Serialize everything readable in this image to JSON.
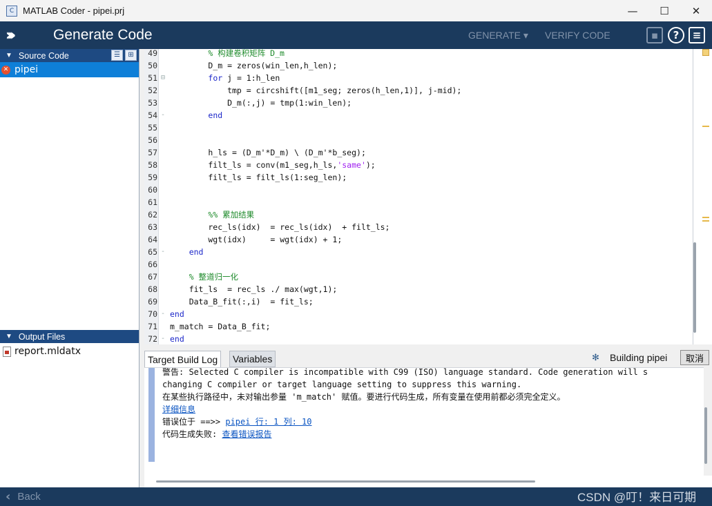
{
  "window": {
    "title": "MATLAB Coder - pipei.prj",
    "app_icon": "matlab-coder-icon",
    "minimize": "—",
    "maximize": "☐",
    "close": "✕"
  },
  "header": {
    "title": "Generate Code",
    "menu_generate": "GENERATE ▾",
    "menu_verify": "VERIFY CODE",
    "save_icon": "save-icon",
    "help_icon": "?",
    "menu_icon": "≡"
  },
  "source_panel": {
    "title": "Source Code",
    "items": [
      {
        "label": "pipei",
        "status": "error"
      }
    ]
  },
  "output_panel": {
    "title": "Output Files",
    "items": [
      {
        "label": "report.mldatx"
      }
    ]
  },
  "editor": {
    "lines": [
      {
        "n": "49",
        "html": "        <span class=\"cm\">% 构建卷积矩阵 D_m</span>"
      },
      {
        "n": "50",
        "html": "        D_m = zeros(win_len,h_len);"
      },
      {
        "n": "51",
        "html": "        <span class=\"kw\">for</span> j = 1:h_len",
        "fold": "⊟"
      },
      {
        "n": "52",
        "html": "            tmp = circshift([m1_seg; zeros(h_len,1)], j-mid);"
      },
      {
        "n": "53",
        "html": "            D_m(:,j) = tmp(1:win_len);"
      },
      {
        "n": "54",
        "html": "        <span class=\"kw\">end</span>",
        "fold": "-"
      },
      {
        "n": "55",
        "html": ""
      },
      {
        "n": "56",
        "html": ""
      },
      {
        "n": "57",
        "html": "        h_ls = (D_m'*D_m) \\ (D_m'*b_seg);"
      },
      {
        "n": "58",
        "html": "        filt_ls = conv(m1_seg,h_ls,<span class=\"str\">'same'</span>);"
      },
      {
        "n": "59",
        "html": "        filt_ls = filt_ls(1:seg_len);"
      },
      {
        "n": "60",
        "html": ""
      },
      {
        "n": "61",
        "html": ""
      },
      {
        "n": "62",
        "html": "        <span class=\"cm\">%% 累加结果</span>"
      },
      {
        "n": "63",
        "html": "        rec_ls(idx)  = rec_ls(idx)  + filt_ls;"
      },
      {
        "n": "64",
        "html": "        wgt(idx)     = wgt(idx) + 1;"
      },
      {
        "n": "65",
        "html": "    <span class=\"kw\">end</span>",
        "fold": "-"
      },
      {
        "n": "66",
        "html": ""
      },
      {
        "n": "67",
        "html": "    <span class=\"cm\">% 整道归一化</span>"
      },
      {
        "n": "68",
        "html": "    fit_ls  = rec_ls ./ max(wgt,1);"
      },
      {
        "n": "69",
        "html": "    Data_B_fit(:,i)  = fit_ls;"
      },
      {
        "n": "70",
        "html": "<span class=\"kw\">end</span>",
        "fold": "-"
      },
      {
        "n": "71",
        "html": "m_match = Data_B_fit;"
      },
      {
        "n": "72",
        "html": "<span class=\"kw\">end</span>",
        "fold": "-"
      }
    ]
  },
  "bottom_tabs": {
    "tab_log": "Target Build Log",
    "tab_vars": "Variables",
    "status": "Building pipei",
    "cancel": "取消"
  },
  "log": {
    "line1": "警告: Selected C compiler is incompatible with C99 (ISO) language standard. Code generation will s",
    "line2": "changing C compiler or target language setting to suppress this warning.",
    "line3": "在某些执行路径中，未对输出参量 'm_match' 赋值。要进行代码生成，所有变量在使用前都必须完全定义。",
    "details_link": "详细信息",
    "error_prefix": "错误位于 ==>> ",
    "error_link": "pipei 行: 1 列: 10",
    "fail_prefix": "代码生成失败: ",
    "fail_link": "查看错误报告"
  },
  "footer": {
    "back": "Back",
    "watermark": "CSDN @叮！来日可期"
  }
}
